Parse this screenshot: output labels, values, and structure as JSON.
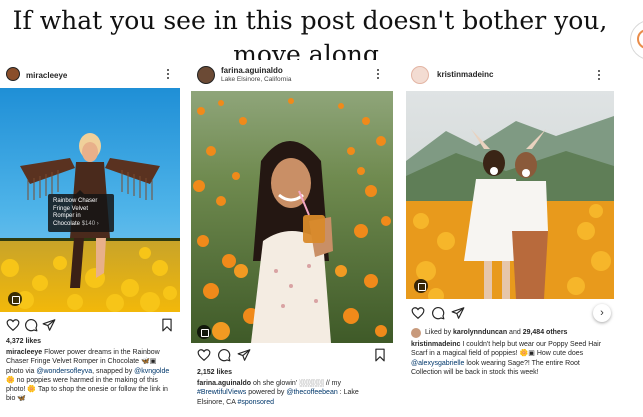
{
  "headline": {
    "line1": "If what you see in this post doesn't bother you,",
    "line2": "move along."
  },
  "colors": {
    "link": "#00376b",
    "text": "#262626",
    "poppy": "#f28a1c"
  },
  "posts": [
    {
      "username": "miracleeye",
      "location": "",
      "tag": {
        "name": "Rainbow Chaser Fringe Velvet Romper in Chocolate",
        "price": "$140 ›"
      },
      "likes": "4,372 likes",
      "caption": {
        "user": "miracleeye",
        "text": "Flower power dreams in the Rainbow Chaser Fringe Velvet Romper in Chocolate 🦋▣ photo via ",
        "mention1": "@wondersofleyva",
        "text2": ", snapped by ",
        "mention2": "@kvngolde",
        "text3": " 🌼 no poppies were harmed in the making of this photo! 🌼 Tap to shop the onesie or follow the link in bio 🦋"
      },
      "icons": [
        "heart-icon",
        "comment-icon",
        "share-icon",
        "bookmark-icon"
      ]
    },
    {
      "username": "farina.aguinaldo",
      "location": "Lake Elsinore, California",
      "likes": "2,152 likes",
      "caption": {
        "user": "farina.aguinaldo",
        "text": "oh she glowin' ░░░░░ // my ",
        "hashtag1": "#BrewtifulViews",
        "text2": " powered by ",
        "mention1": "@thecoffeebean",
        "text3": " : Lake Elsinore, CA ",
        "hashtag2": "#sponsored"
      },
      "icons": [
        "heart-icon",
        "comment-icon",
        "share-icon",
        "bookmark-icon"
      ]
    },
    {
      "username": "kristinmadeinc",
      "location": "",
      "liked_by": {
        "prefix": "Liked by ",
        "user": "karolynnduncan",
        "middle": " and ",
        "others": "29,484 others"
      },
      "caption": {
        "user": "kristinmadeinc",
        "text": "I couldn't help but wear our Poppy Seed Hair Scarf in a magical field of poppies! 🌼▣ How cute does ",
        "mention1": "@alexysgabrielle",
        "text2": " look wearing Sage?! The entire Root Collection will be back in stock this week!"
      },
      "next_label": "›",
      "icons": [
        "heart-icon",
        "comment-icon",
        "share-icon"
      ]
    }
  ]
}
